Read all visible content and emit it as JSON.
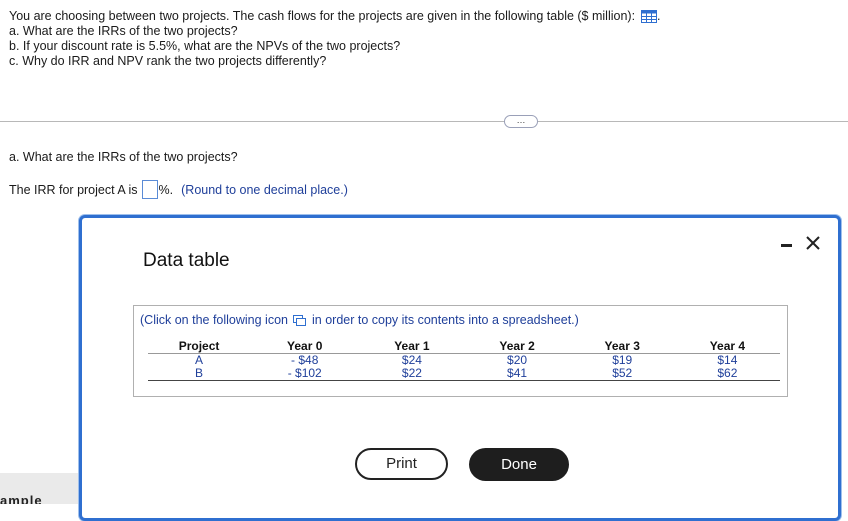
{
  "question": {
    "intro": "You are choosing between two projects. The cash flows for the projects are given in the following table ($ million):",
    "intro_end": ".",
    "part_a": "a. What are the IRRs of the two projects?",
    "part_b": "b. If your discount rate is 5.5%, what are the NPVs of the two projects?",
    "part_c": "c. Why do IRR and NPV rank the two projects differently?"
  },
  "more_button": "…",
  "sub_question": "a. What are the IRRs of the two projects?",
  "answer": {
    "prefix": "The IRR for project A is",
    "suffix": "%.",
    "hint": "(Round to one decimal place.)",
    "value": ""
  },
  "bottom_left_fragment": "ample",
  "modal": {
    "title": "Data table",
    "copy_note_before": "(Click on the following icon",
    "copy_note_after": "in order to copy its contents into a spreadsheet.)",
    "columns": [
      "Project",
      "Year 0",
      "Year 1",
      "Year 2",
      "Year 3",
      "Year 4"
    ],
    "rows": [
      [
        "A",
        "- $48",
        "$24",
        "$20",
        "$19",
        "$14"
      ],
      [
        "B",
        "- $102",
        "$22",
        "$41",
        "$52",
        "$62"
      ]
    ],
    "print_label": "Print",
    "done_label": "Done"
  },
  "colors": {
    "accent_blue": "#2f6fd0",
    "link_blue": "#1f3f9a",
    "done_bg": "#1e1e1e"
  },
  "icons": [
    "table-icon",
    "copy-icon",
    "minimize-icon",
    "close-icon"
  ]
}
